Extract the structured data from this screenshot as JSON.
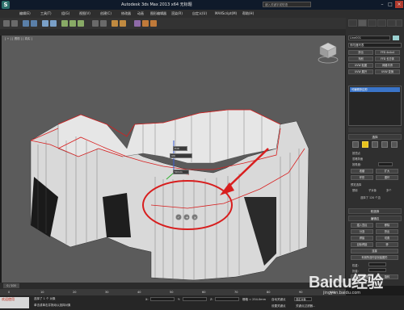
{
  "title_bar": {
    "title": "Autodesk 3ds Max  2013 x64   无标题",
    "search_placeholder": "键入关键字或短语",
    "min": "–",
    "max": "□",
    "close": "×"
  },
  "menubar": {
    "items": [
      "编辑(E)",
      "工具(T)",
      "组(G)",
      "视图(V)",
      "创建(C)",
      "修改器",
      "动画",
      "图形编辑器",
      "渲染(R)",
      "自定义(U)",
      "MAXScript(M)",
      "帮助(H)"
    ]
  },
  "viewport": {
    "label": "[ + ] [ 透视 ] [ 真实 ]",
    "tooltip_lines": [
      "Edit",
      "Uth",
      "50mm"
    ],
    "caddy_icons": [
      "check-icon",
      "plus-icon",
      "cancel-icon"
    ]
  },
  "command_panel": {
    "object_name": "Line001",
    "object_color": "#9ad0d0",
    "modifier_list": "修改器列表",
    "modifier_buttons": [
      "挤出",
      "FFD 4x4x4",
      "车削",
      "FFD 长方体",
      "UVW 贴图",
      "网格平滑",
      "UVW 展开",
      "UVW 变换"
    ],
    "stack_item": "可编辑多边形",
    "selection_rollout": "选择",
    "selection_options": [
      "按顶点",
      "忽略背面",
      "按角度:",
      "收缩",
      "扩大",
      "环形",
      "循环"
    ],
    "preview_selection": "预览选择",
    "preview_options": [
      "禁用",
      "子对象",
      "多个"
    ],
    "selected_count": "选择了 120 个边",
    "soft_selection": "软选择",
    "edit_edges": "编辑边",
    "edit_buttons": [
      "插入顶点",
      "移除",
      "分割",
      "挤出",
      "焊接",
      "切角",
      "目标焊接",
      "桥",
      "连接"
    ],
    "create_shape": "利用所选内容创建图形",
    "weight_label": "权重:",
    "crease_label": "折缝:",
    "edit_tri": "编辑三角形",
    "turn": "旋转"
  },
  "timeline": {
    "frame": "0 / 100",
    "ticks": [
      "0",
      "10",
      "20",
      "30",
      "40",
      "50",
      "60",
      "70",
      "80",
      "90",
      "100"
    ]
  },
  "status": {
    "listener": "欢迎使用",
    "line1": "选择了 1 个 对象",
    "line2": "单击或单击并拖动以选择对象",
    "x_label": "X:",
    "y_label": "Y:",
    "z_label": "Z:",
    "grid": "栅格 = 254.0mm",
    "autokey": "自动关键点",
    "setkey": "设置关键点",
    "selected": "选定对象",
    "key_filters": "关键点过滤器..."
  },
  "watermark": {
    "brand": "Baidu经验",
    "url": "jingyan.baidu.com"
  },
  "colors": {
    "annotation": "#d81e1e",
    "viewport_bg": "#5b5b5b",
    "selection_blue": "#3a74c8"
  }
}
